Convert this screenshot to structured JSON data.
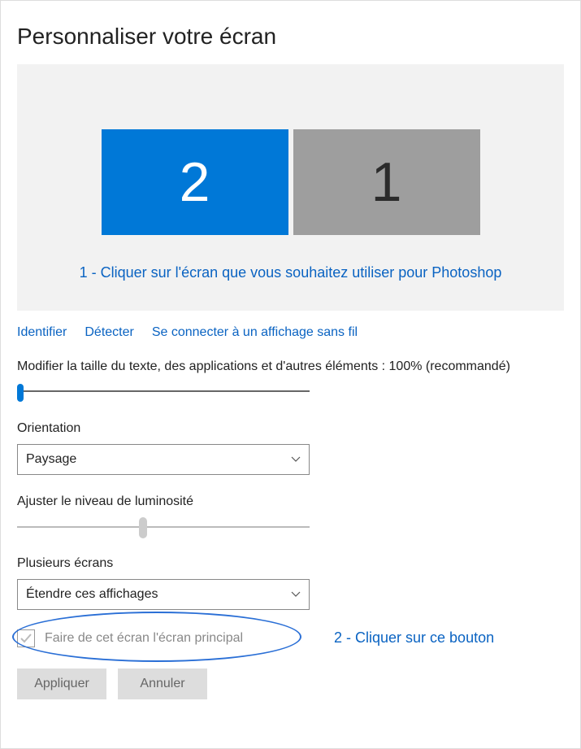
{
  "title": "Personnaliser votre écran",
  "monitors": {
    "selected": "2",
    "unselected": "1"
  },
  "annotation_monitor": "1 - Cliquer sur l'écran que vous souhaitez utiliser pour Photoshop",
  "links": {
    "identify": "Identifier",
    "detect": "Détecter",
    "wireless": "Se connecter à un affichage sans fil"
  },
  "scale_label": "Modifier la taille du texte, des applications et d'autres éléments : 100% (recommandé)",
  "orientation": {
    "label": "Orientation",
    "value": "Paysage"
  },
  "brightness_label": "Ajuster le niveau de luminosité",
  "multi": {
    "label": "Plusieurs écrans",
    "value": "Étendre ces affichages"
  },
  "checkbox_label": "Faire de cet écran l'écran principal",
  "annotation_checkbox": "2 - Cliquer sur ce bouton",
  "buttons": {
    "apply": "Appliquer",
    "cancel": "Annuler"
  }
}
